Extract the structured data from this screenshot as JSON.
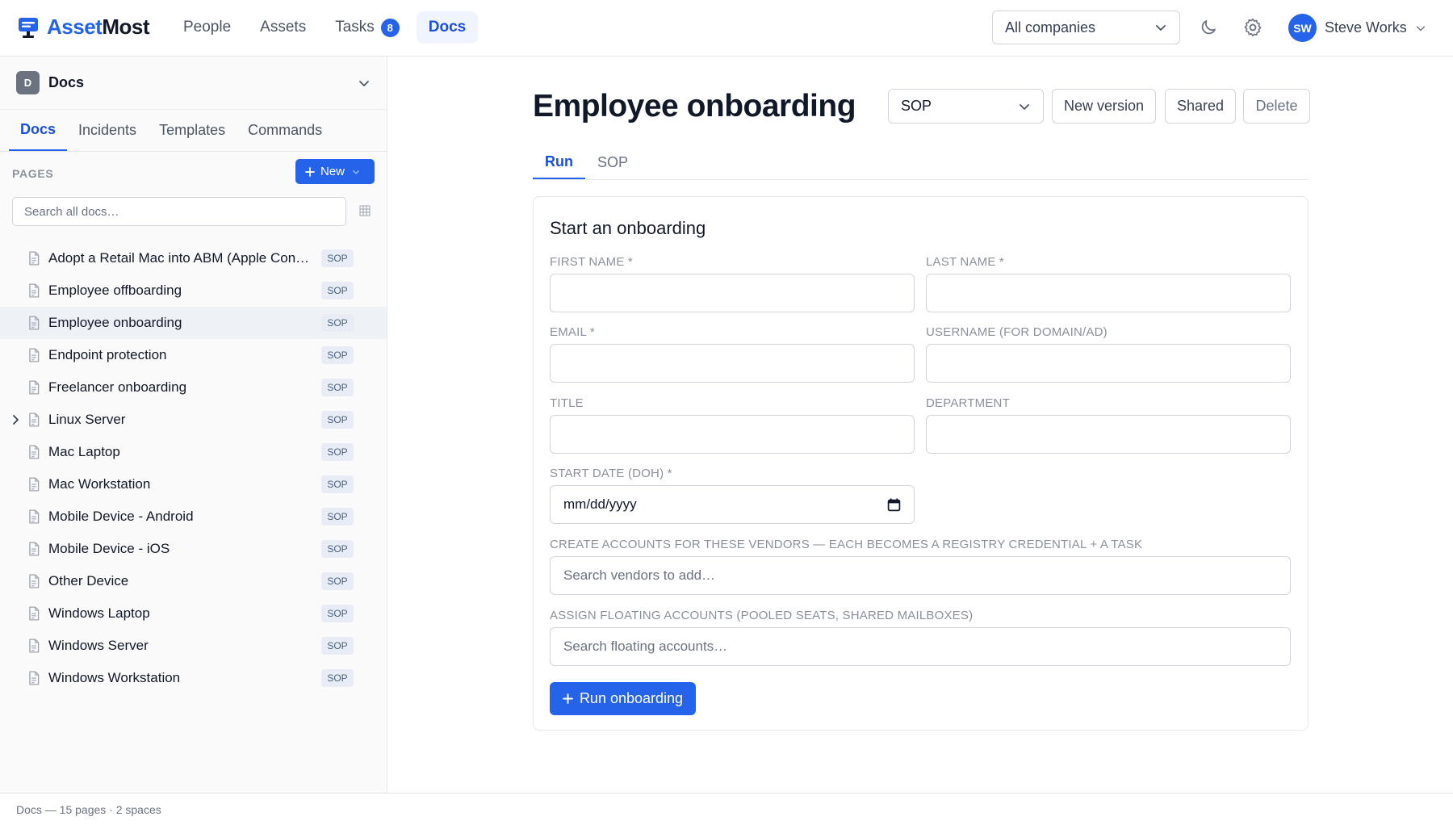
{
  "app": {
    "brand_part1": "Asset",
    "brand_part2": "Most",
    "accent_color": "#2563eb"
  },
  "nav": {
    "items": [
      {
        "label": "People"
      },
      {
        "label": "Assets"
      },
      {
        "label": "Tasks",
        "badge": "8"
      },
      {
        "label": "Docs",
        "active": true
      }
    ]
  },
  "header": {
    "company_select": "All companies",
    "theme_icon": "moon-icon",
    "settings_icon": "gear-icon",
    "user_initials": "SW",
    "user_name": "Steve Works"
  },
  "sidebar": {
    "space_initial": "D",
    "space_name": "Docs",
    "tabs": [
      "Docs",
      "Incidents",
      "Templates",
      "Commands"
    ],
    "active_tab": "Docs",
    "pages_label": "PAGES",
    "new_button": "New",
    "search_placeholder": "Search all docs…",
    "pages": [
      {
        "title": "Adopt a Retail Mac into ABM (Apple Con…",
        "tag": "SOP"
      },
      {
        "title": "Employee offboarding",
        "tag": "SOP"
      },
      {
        "title": "Employee onboarding",
        "tag": "SOP",
        "active": true
      },
      {
        "title": "Endpoint protection",
        "tag": "SOP"
      },
      {
        "title": "Freelancer onboarding",
        "tag": "SOP"
      },
      {
        "title": "Linux Server",
        "tag": "SOP",
        "expandable": true
      },
      {
        "title": "Mac Laptop",
        "tag": "SOP"
      },
      {
        "title": "Mac Workstation",
        "tag": "SOP"
      },
      {
        "title": "Mobile Device - Android",
        "tag": "SOP"
      },
      {
        "title": "Mobile Device - iOS",
        "tag": "SOP"
      },
      {
        "title": "Other Device",
        "tag": "SOP"
      },
      {
        "title": "Windows Laptop",
        "tag": "SOP"
      },
      {
        "title": "Windows Server",
        "tag": "SOP"
      },
      {
        "title": "Windows Workstation",
        "tag": "SOP"
      }
    ]
  },
  "footer": {
    "status": "Docs — 15 pages · 2 spaces"
  },
  "main": {
    "title": "Employee onboarding",
    "type_select": "SOP",
    "buttons": {
      "new_version": "New version",
      "shared": "Shared",
      "delete": "Delete"
    },
    "tabs": [
      "Run",
      "SOP"
    ],
    "active_tab": "Run",
    "form": {
      "heading": "Start an onboarding",
      "first_name_label": "FIRST NAME *",
      "last_name_label": "LAST NAME *",
      "email_label": "EMAIL *",
      "username_label": "USERNAME (FOR DOMAIN/AD)",
      "title_label": "TITLE",
      "department_label": "DEPARTMENT",
      "start_date_label": "START DATE (DOH) *",
      "start_date_value": "mm/dd/yyyy",
      "vendors_label": "CREATE ACCOUNTS FOR THESE VENDORS — EACH BECOMES A REGISTRY CREDENTIAL + A TASK",
      "vendors_placeholder": "Search vendors to add…",
      "floating_label": "ASSIGN FLOATING ACCOUNTS (POOLED SEATS, SHARED MAILBOXES)",
      "floating_placeholder": "Search floating accounts…",
      "submit": "Run onboarding"
    }
  }
}
